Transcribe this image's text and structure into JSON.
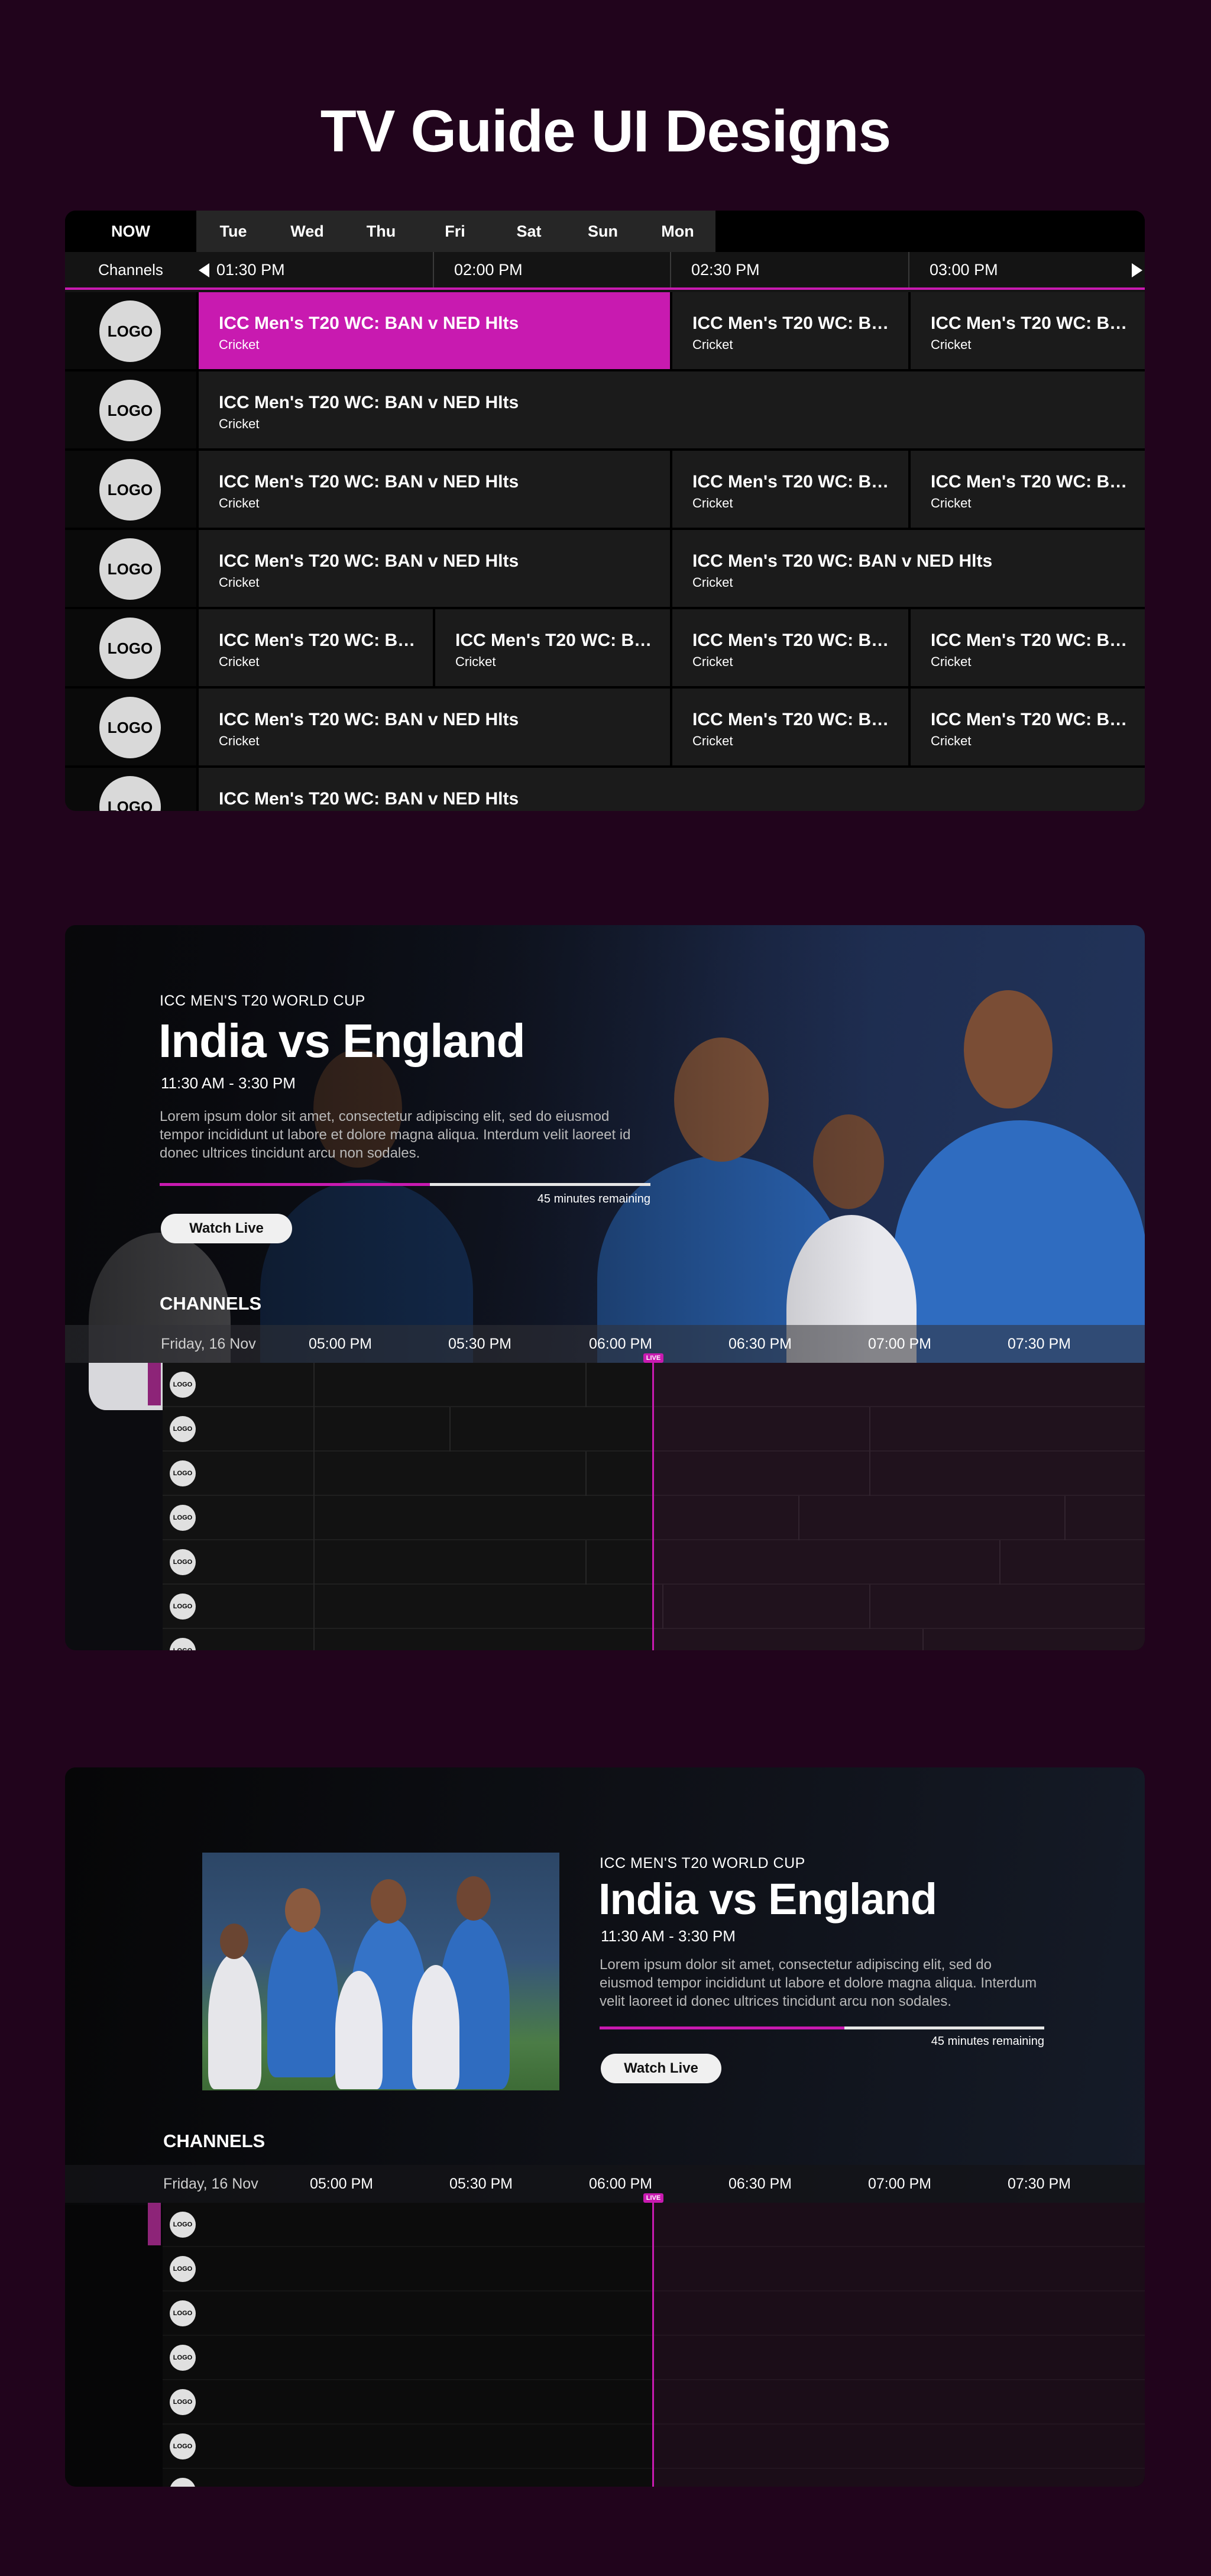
{
  "page": {
    "title": "TV Guide UI Designs"
  },
  "guide": {
    "tabs": [
      "NOW",
      "Tue",
      "Wed",
      "Thu",
      "Fri",
      "Sat",
      "Sun",
      "Mon"
    ],
    "channels_label": "Channels",
    "times": [
      "01:30 PM",
      "02:00 PM",
      "02:30 PM",
      "03:00 PM"
    ],
    "logo_text": "LOGO",
    "rows": [
      {
        "programs": [
          {
            "title": "ICC Men's T20 WC: BAN v NED Hlts",
            "genre": "Cricket",
            "active": true
          },
          {
            "title": "ICC Men's T20 WC: BAN v ...",
            "genre": "Cricket"
          },
          {
            "title": "ICC Men's T20 WC: BAN v ...",
            "genre": "Cricket"
          }
        ]
      },
      {
        "programs": [
          {
            "title": "ICC Men's T20 WC: BAN v NED Hlts",
            "genre": "Cricket"
          }
        ]
      },
      {
        "programs": [
          {
            "title": "ICC Men's T20 WC: BAN v NED Hlts",
            "genre": "Cricket"
          },
          {
            "title": "ICC Men's T20 WC: BAN ...",
            "genre": "Cricket"
          },
          {
            "title": "ICC Men's T20 WC: BAN ...",
            "genre": "Cricket"
          }
        ]
      },
      {
        "programs": [
          {
            "title": "ICC Men's T20 WC: BAN v NED Hlts",
            "genre": "Cricket"
          },
          {
            "title": "ICC Men's T20 WC: BAN v NED Hlts",
            "genre": "Cricket"
          }
        ]
      },
      {
        "programs": [
          {
            "title": "ICC Men's T20 WC: BAN ...",
            "genre": "Cricket"
          },
          {
            "title": "ICC Men's T20 WC: BAN ...",
            "genre": "Cricket"
          },
          {
            "title": "ICC Men's T20 WC: BAN ...",
            "genre": "Cricket"
          },
          {
            "title": "ICC Men's T20 WC: BAN ...",
            "genre": "Cricket"
          }
        ]
      },
      {
        "programs": [
          {
            "title": "ICC Men's T20 WC: BAN v NED Hlts",
            "genre": "Cricket"
          },
          {
            "title": "ICC Men's T20 WC: BAN ...",
            "genre": "Cricket"
          },
          {
            "title": "ICC Men's T20 WC: BAN ...",
            "genre": "Cricket"
          }
        ]
      },
      {
        "programs": [
          {
            "title": "ICC Men's T20 WC: BAN v NED Hlts",
            "genre": ""
          }
        ]
      }
    ]
  },
  "hero": {
    "category": "ICC MEN'S T20 WORLD CUP",
    "title": "India vs England",
    "time_range": "11:30 AM - 3:30 PM",
    "description": "Lorem ipsum dolor sit amet, consectetur adipiscing elit, sed do eiusmod tempor incididunt ut labore et dolore magna aliqua. Interdum velit laoreet id donec ultrices tincidunt arcu non sodales.",
    "progress": 0.55,
    "remaining": "45 minutes remaining",
    "watch_label": "Watch Live"
  },
  "timeline": {
    "channels_title": "CHANNELS",
    "date": "Friday, 16 Nov",
    "times": [
      "05:00 PM",
      "05:30 PM",
      "06:00 PM",
      "06:30 PM",
      "07:00 PM",
      "07:30 PM"
    ],
    "live_label": "LIVE",
    "logo_text": "LOGO",
    "row_count": 7
  },
  "colors": {
    "background": "#21041c",
    "accent": "#c81ab0",
    "panel": "#141414"
  }
}
